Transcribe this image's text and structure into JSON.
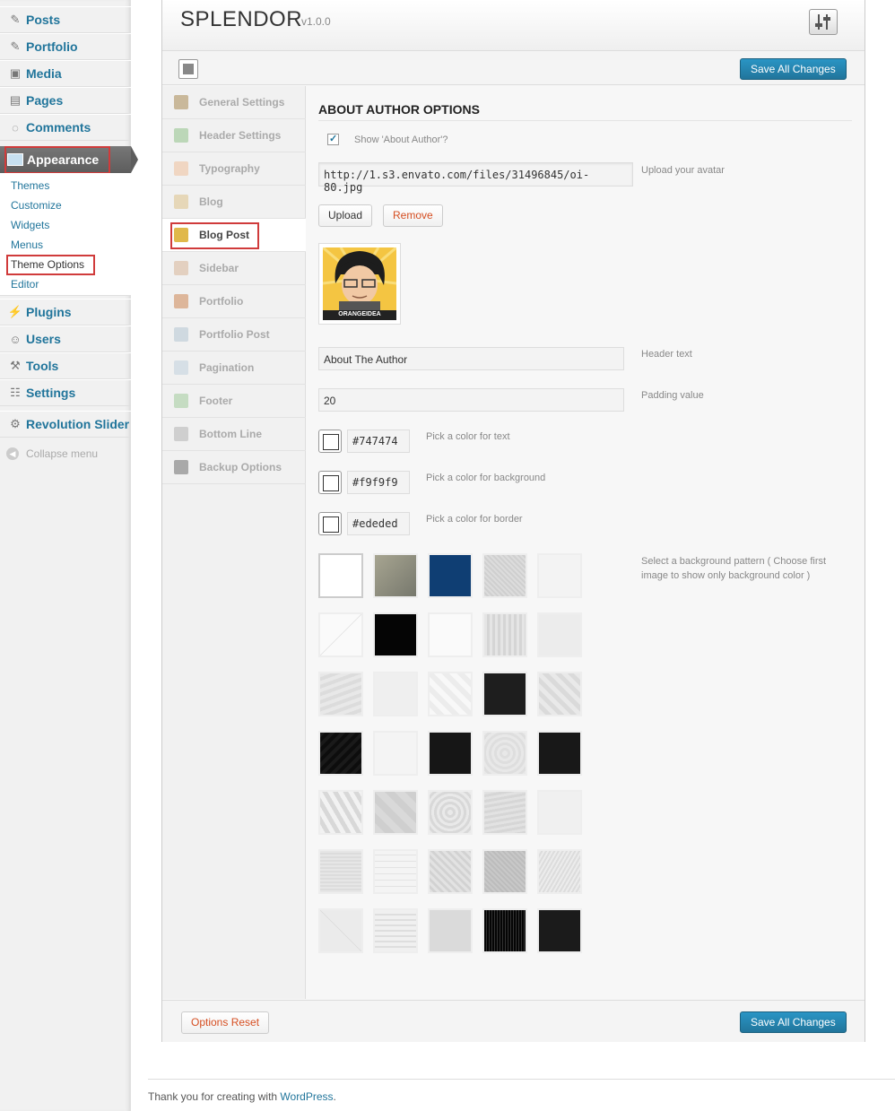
{
  "menu": {
    "items": [
      {
        "label": "Posts",
        "icon": "pin-icon"
      },
      {
        "label": "Portfolio",
        "icon": "pin-icon"
      },
      {
        "label": "Media",
        "icon": "media-icon"
      },
      {
        "label": "Pages",
        "icon": "pages-icon"
      },
      {
        "label": "Comments",
        "icon": "comment-icon"
      },
      {
        "label": "Appearance",
        "icon": "appearance-icon"
      },
      {
        "label": "Plugins",
        "icon": "plugin-icon"
      },
      {
        "label": "Users",
        "icon": "users-icon"
      },
      {
        "label": "Tools",
        "icon": "tools-icon"
      },
      {
        "label": "Settings",
        "icon": "settings-icon"
      },
      {
        "label": "Revolution Slider",
        "icon": "gear-icon"
      }
    ],
    "submenu": [
      "Themes",
      "Customize",
      "Widgets",
      "Menus",
      "Theme Options",
      "Editor"
    ],
    "collapse": "Collapse menu"
  },
  "header": {
    "title": "SPLENDOR",
    "version": "v1.0.0"
  },
  "buttons": {
    "save": "Save All Changes",
    "reset": "Options Reset",
    "upload": "Upload",
    "remove": "Remove"
  },
  "nav": [
    "General Settings",
    "Header Settings",
    "Typography",
    "Blog",
    "Blog Post",
    "Sidebar",
    "Portfolio",
    "Portfolio Post",
    "Pagination",
    "Footer",
    "Bottom Line",
    "Backup Options"
  ],
  "section": {
    "title": "ABOUT AUTHOR OPTIONS",
    "show_label": "Show 'About Author'?",
    "avatar_url": "http://1.s3.envato.com/files/31496845/oi-80.jpg",
    "avatar_label": "Upload your avatar",
    "avatar_caption": "ORANGEIDEA",
    "header_text": "About The Author",
    "header_label": "Header text",
    "padding": "20",
    "padding_label": "Padding value",
    "text_color": "#747474",
    "text_color_label": "Pick a color for text",
    "bg_color": "#f9f9f9",
    "bg_color_label": "Pick a color for background",
    "border_color": "#ededed",
    "border_color_label": "Pick a color for border",
    "pattern_label": "Select a background pattern ( Choose first image to show only background color )"
  },
  "footer": {
    "text": "Thank you for creating with ",
    "link": "WordPress",
    "end": "."
  }
}
